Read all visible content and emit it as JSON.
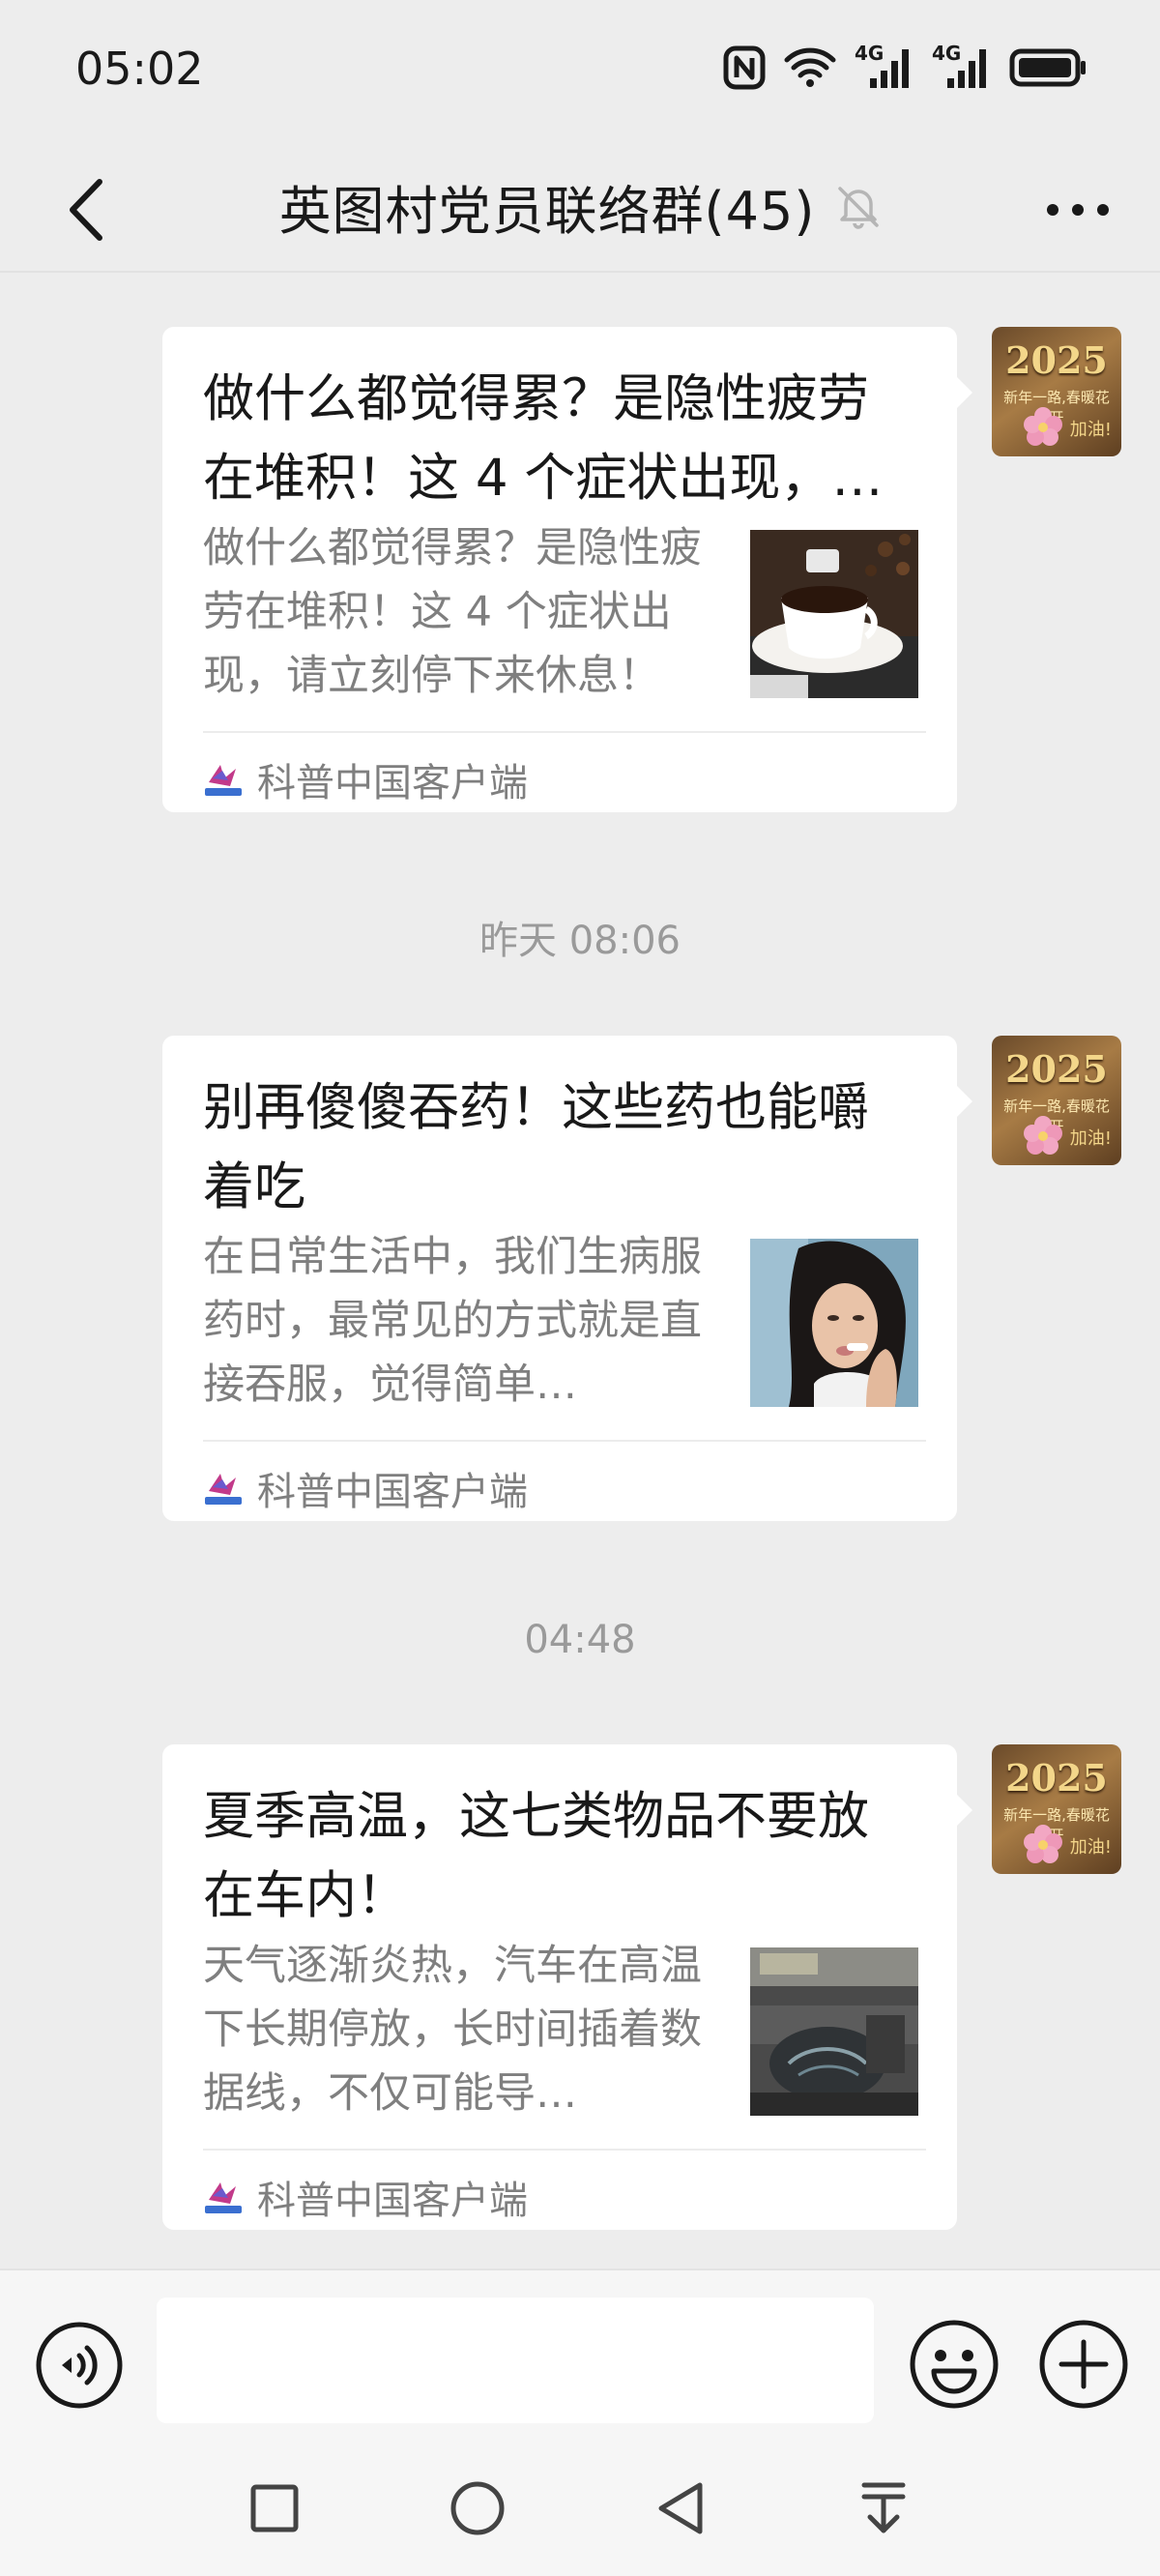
{
  "status_bar": {
    "time": "05:02",
    "signal_1_label": "4G",
    "signal_2_label": "4G"
  },
  "header": {
    "title": "英图村党员联络群(45)",
    "icons": [
      "back-arrow-icon",
      "mute-bell-icon",
      "more-dots-icon"
    ]
  },
  "avatar": {
    "year": "2025",
    "blessing": "新年一路,春暖花开",
    "cheer": "加油!"
  },
  "messages": [
    {
      "title": "做什么都觉得累？是隐性疲劳在堆积！这 4 个症状出现，…",
      "description": "做什么都觉得累？是隐性疲劳在堆积！这 4 个症状出现，请立刻停下来休息！",
      "thumbnail": "coffee-cup",
      "source": "科普中国客户端"
    },
    {
      "timestamp": "昨天 08:06",
      "title": "别再傻傻吞药！这些药也能嚼着吃",
      "description": "在日常生活中，我们生病服药时，最常见的方式就是直接吞服，觉得简单…",
      "thumbnail": "woman-taking-pill",
      "source": "科普中国客户端"
    },
    {
      "timestamp": "04:48",
      "title": "夏季高温，这七类物品不要放在车内！",
      "description": "天气逐渐炎热，汽车在高温下长期停放，长时间插着数据线，不仅可能导…",
      "thumbnail": "car-interior",
      "source": "科普中国客户端"
    }
  ],
  "input_bar": {
    "placeholder": "",
    "icons": [
      "voice-icon",
      "emoji-icon",
      "plus-icon"
    ]
  },
  "nav_bar": {
    "icons": [
      "recent-apps-icon",
      "home-icon",
      "back-icon",
      "notification-pull-icon"
    ]
  },
  "colors": {
    "background": "#ededed",
    "card": "#ffffff",
    "secondary_text": "#7f7f7f",
    "timestamp_text": "#9a9a9a"
  }
}
